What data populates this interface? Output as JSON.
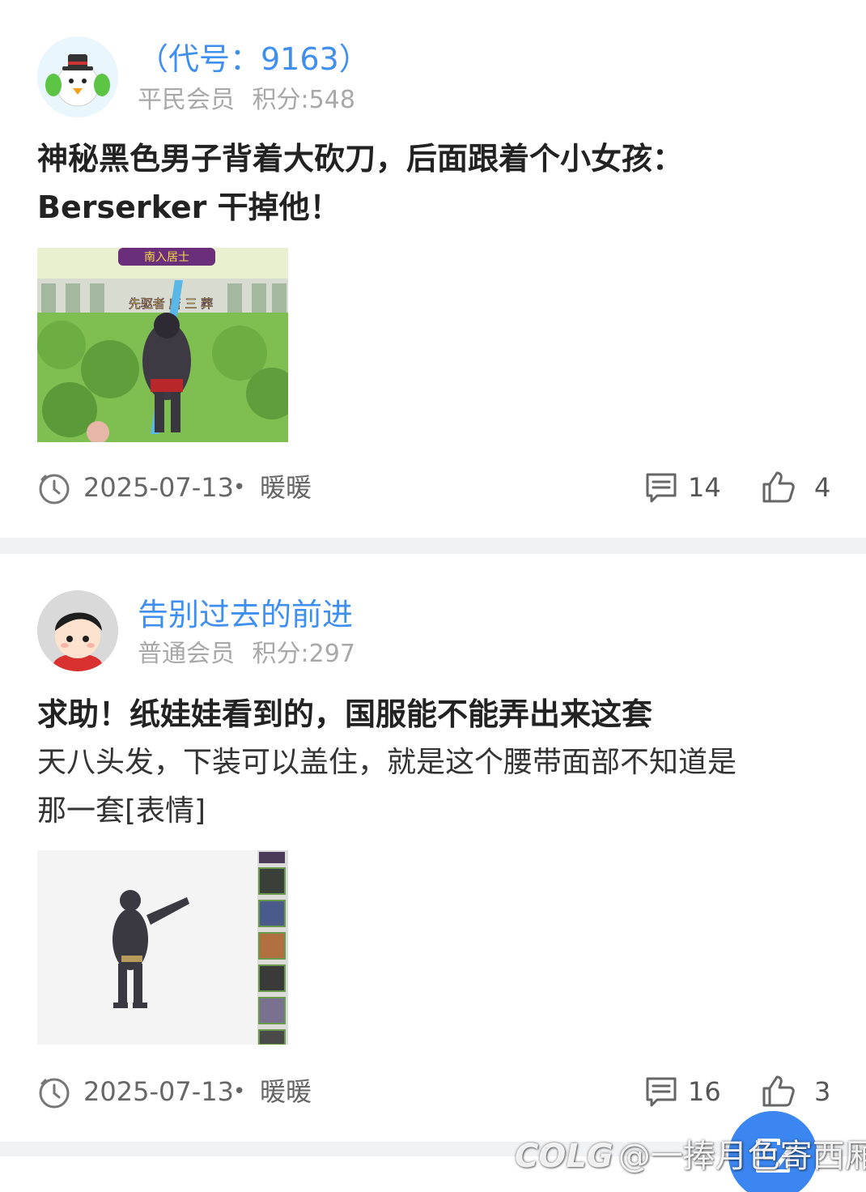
{
  "posts": [
    {
      "username": "（代号：9163）",
      "member_level": "平民会员",
      "points": "积分:548",
      "title_lines": [
        "神秘黑色男子背着大砍刀，后面跟着个小女孩：",
        "Berserker 干掉他！"
      ],
      "body_lines": [],
      "image": {
        "banner_text": "南入居士",
        "name_tag": "先驱者 唐 三 葬"
      },
      "date": "2025-07-13",
      "separator": "•",
      "author": "暖暖",
      "comment_count": "14",
      "like_count": "4"
    },
    {
      "username": "告别过去的前进",
      "member_level": "普通会员",
      "points": "积分:297",
      "title_lines": [
        "求助！纸娃娃看到的，国服能不能弄出来这套"
      ],
      "body_lines": [
        "天八头发，下装可以盖住，就是这个腰带面部不知道是",
        "那一套[表情]"
      ],
      "date": "2025-07-13",
      "separator": "•",
      "author": "暖暖",
      "comment_count": "16",
      "like_count": "3"
    }
  ],
  "watermark": {
    "logo": "COLG",
    "text": "@一捧月色寄西厢"
  },
  "colors": {
    "username": "#3f8ff0",
    "fab": "#3b86f0",
    "divider": "#f1f2f4"
  },
  "icons": [
    "clock-icon",
    "comment-icon",
    "thumb-up-icon",
    "compose-icon"
  ]
}
